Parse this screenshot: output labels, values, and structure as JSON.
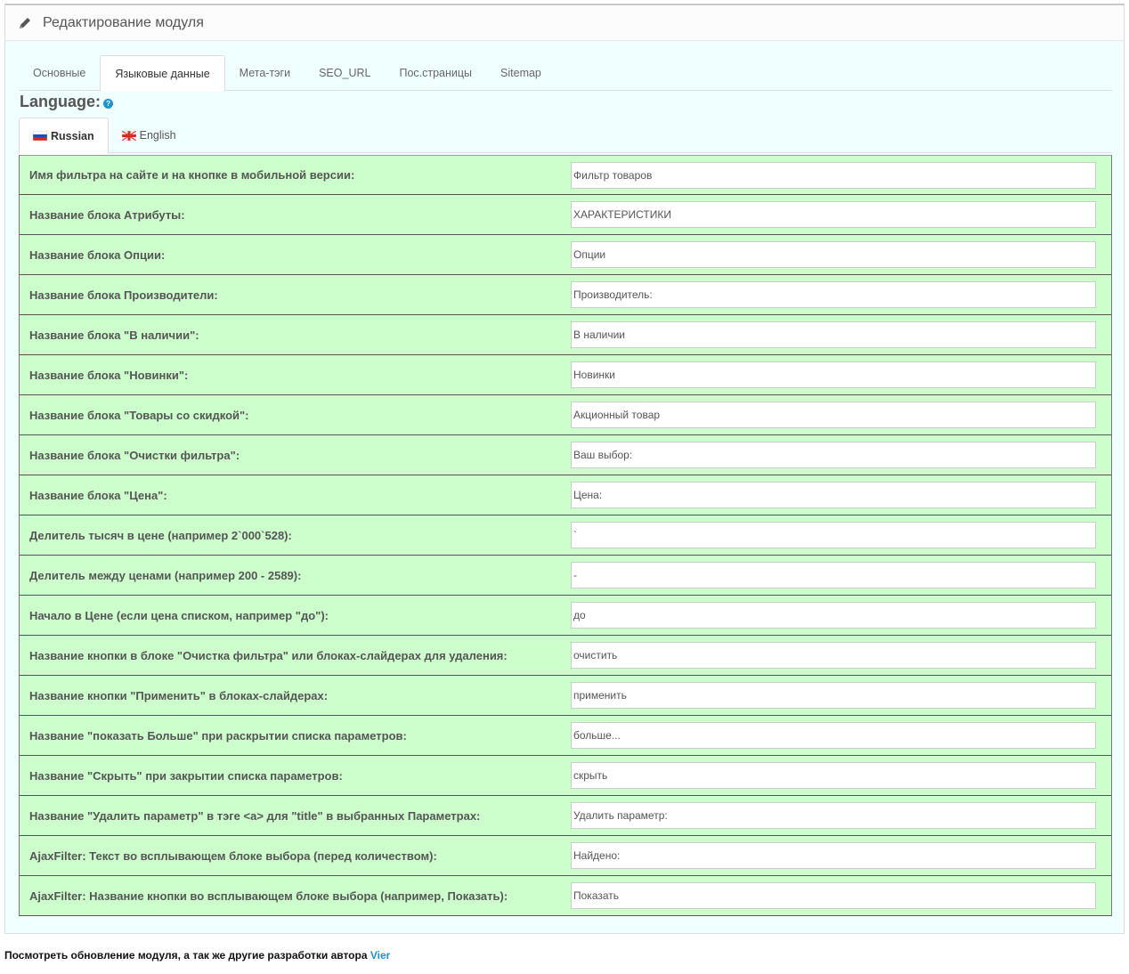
{
  "header": {
    "title": "Редактирование модуля"
  },
  "tabs": [
    {
      "label": "Основные"
    },
    {
      "label": "Языковые данные"
    },
    {
      "label": "Мета-тэги"
    },
    {
      "label": "SEO_URL"
    },
    {
      "label": "Пос.страницы"
    },
    {
      "label": "Sitemap"
    }
  ],
  "language": {
    "title": "Language:",
    "help": "?"
  },
  "lang_tabs": [
    {
      "label": "Russian"
    },
    {
      "label": "English"
    }
  ],
  "rows": [
    {
      "label": "Имя фильтра на сайте и на кнопке в мобильной версии:",
      "value": "Фильтр товаров"
    },
    {
      "label": "Название блока Атрибуты:",
      "value": "ХАРАКТЕРИСТИКИ"
    },
    {
      "label": "Название блока Опции:",
      "value": "Опции"
    },
    {
      "label": "Название блока Производители:",
      "value": "Производитель:"
    },
    {
      "label": "Название блока \"В наличии\":",
      "value": "В наличии"
    },
    {
      "label": "Название блока \"Новинки\":",
      "value": "Новинки"
    },
    {
      "label": "Название блока \"Товары со скидкой\":",
      "value": "Акционный товар"
    },
    {
      "label": "Название блока \"Очистки фильтра\":",
      "value": "Ваш выбор:"
    },
    {
      "label": "Название блока \"Цена\":",
      "value": "Цена:"
    },
    {
      "label": "Делитель тысяч в цене (например 2`000`528):",
      "value": "`"
    },
    {
      "label": "Делитель между ценами (например 200 - 2589):",
      "value": "-"
    },
    {
      "label": "Начало в Цене (если цена списком, например \"до\"):",
      "value": "до"
    },
    {
      "label": "Название кнопки в блоке \"Очистка фильтра\" или блоках-слайдерах для удаления:",
      "value": "очистить"
    },
    {
      "label": "Название кнопки \"Применить\" в блоках-слайдерах:",
      "value": "применить"
    },
    {
      "label": "Название \"показать Больше\" при раскрытии списка параметров:",
      "value": "больше..."
    },
    {
      "label": "Название \"Скрыть\" при закрытии списка параметров:",
      "value": "скрыть"
    },
    {
      "label": "Название \"Удалить параметр\" в тэге <a> для \"title\" в выбранных Параметрах:",
      "value": "Удалить параметр:"
    },
    {
      "label": "AjaxFilter: Текст во всплывающем блоке выбора (перед количеством):",
      "value": "Найдено:"
    },
    {
      "label": "AjaxFilter: Название кнопки во всплывающем блоке выбора (например, Показать):",
      "value": "Показать"
    }
  ],
  "footer": {
    "text": "Посмотреть обновление модуля, а так же другие разработки автора ",
    "link": "Vier"
  }
}
